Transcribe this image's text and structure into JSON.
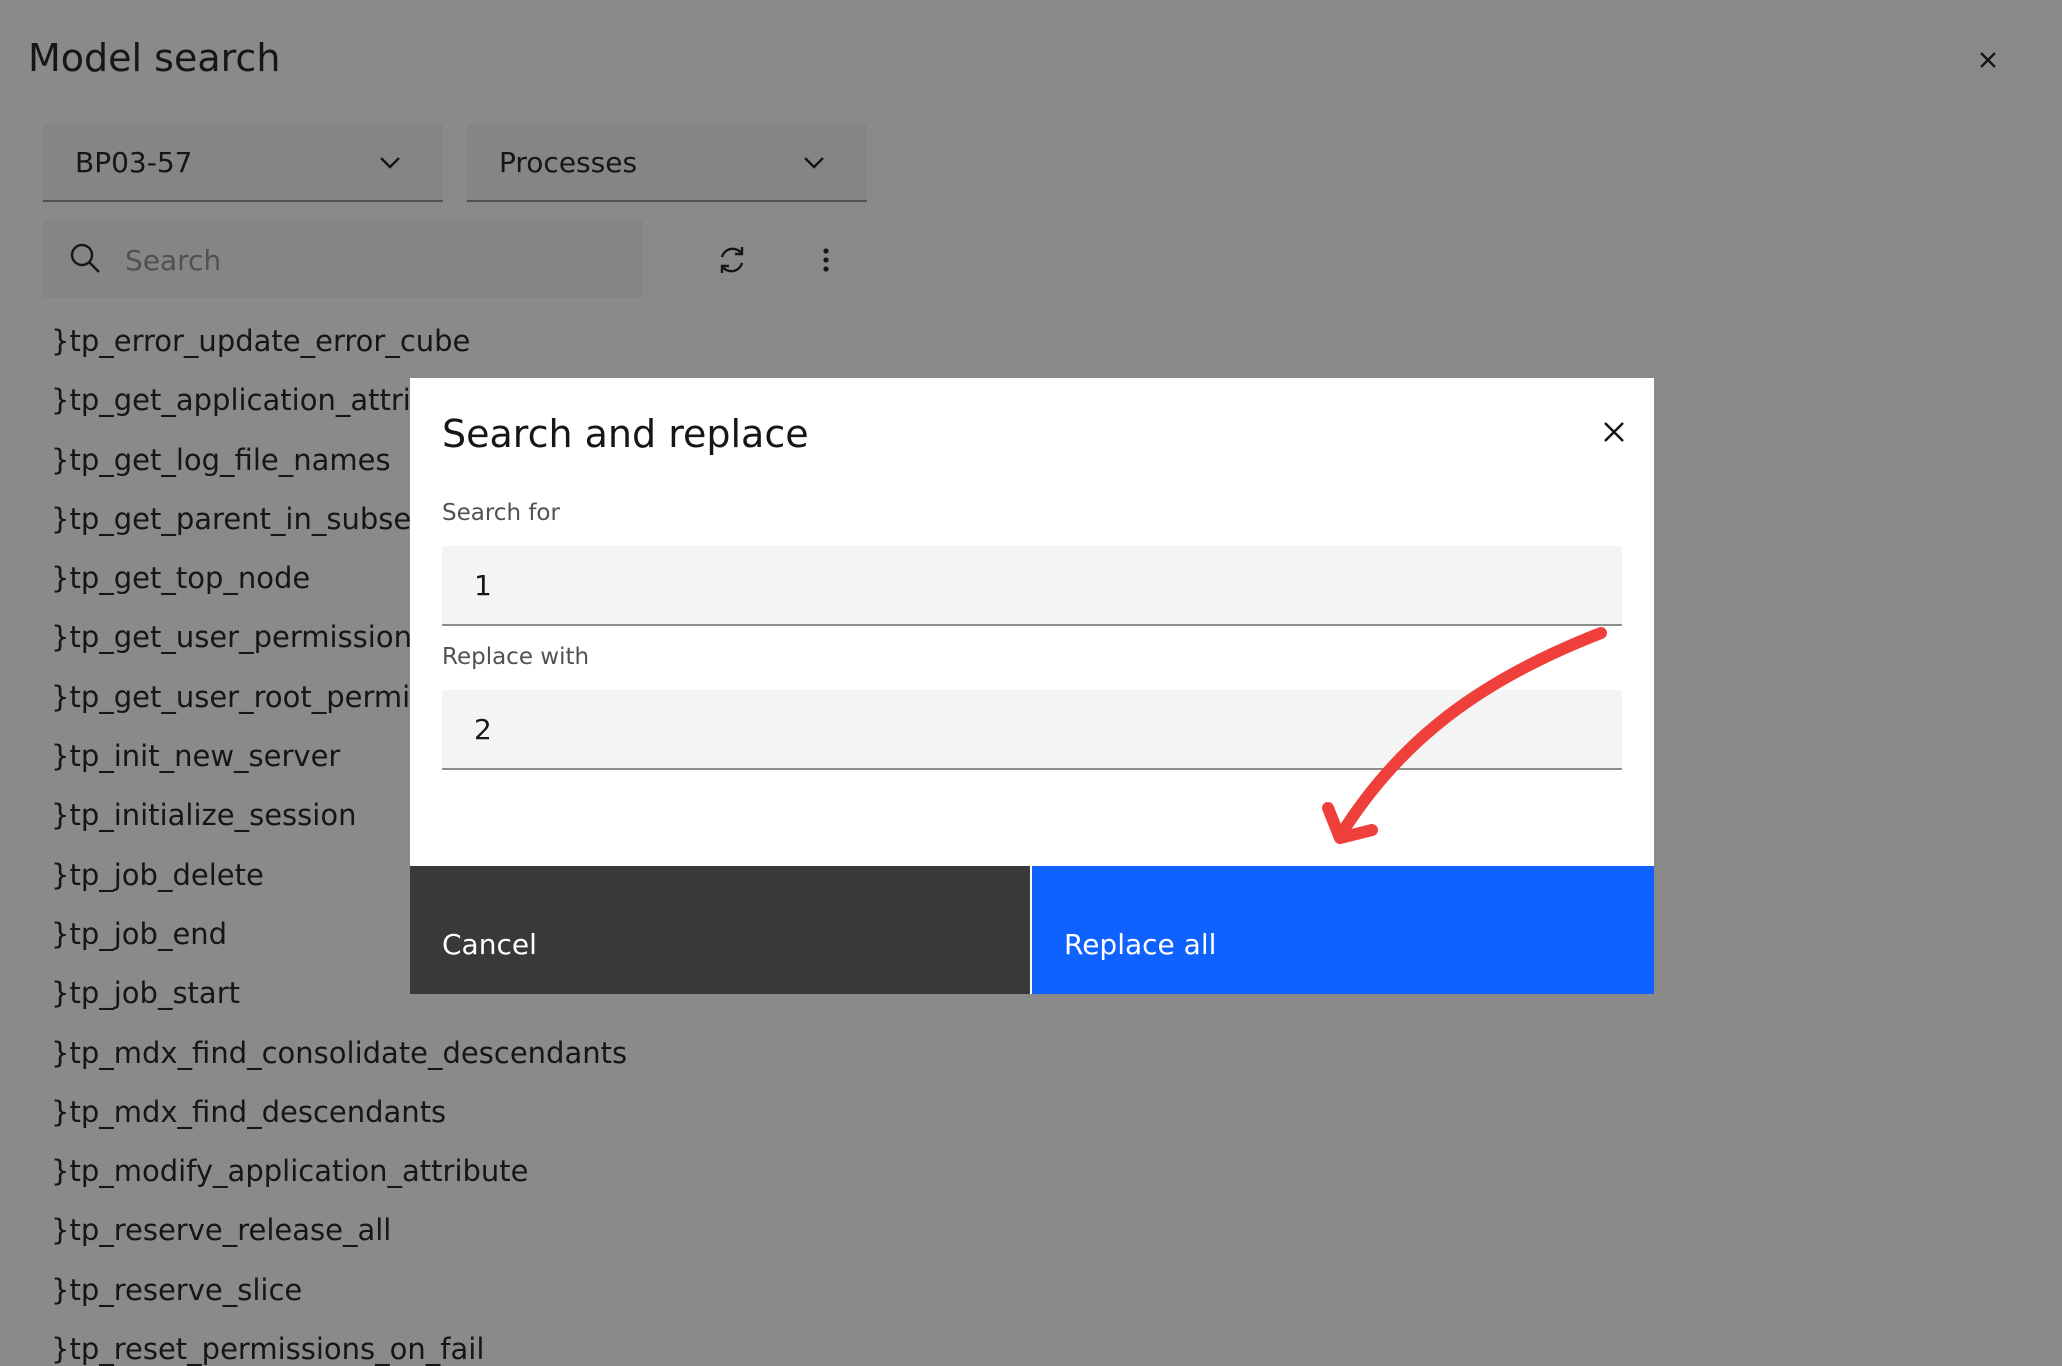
{
  "panel": {
    "title": "Model search",
    "model_dropdown": {
      "selected": "BP03-57"
    },
    "type_dropdown": {
      "selected": "Processes"
    },
    "search": {
      "placeholder": "Search",
      "value": ""
    },
    "items": [
      "}tp_error_update_error_cube",
      "}tp_get_application_attribute",
      "}tp_get_log_file_names",
      "}tp_get_parent_in_subset",
      "}tp_get_top_node",
      "}tp_get_user_permissions",
      "}tp_get_user_root_permissions",
      "}tp_init_new_server",
      "}tp_initialize_session",
      "}tp_job_delete",
      "}tp_job_end",
      "}tp_job_start",
      "}tp_mdx_find_consolidate_descendants",
      "}tp_mdx_find_descendants",
      "}tp_modify_application_attribute",
      "}tp_reserve_release_all",
      "}tp_reserve_slice",
      "}tp_reset_permissions_on_fail"
    ],
    "icons": {
      "close": "close-icon",
      "chevron": "chevron-down-icon",
      "search": "search-icon",
      "refresh": "refresh-icon",
      "more": "overflow-menu-icon"
    }
  },
  "dialog": {
    "title": "Search and replace",
    "search_for_label": "Search for",
    "search_for_value": "1",
    "replace_with_label": "Replace with",
    "replace_with_value": "2",
    "cancel_label": "Cancel",
    "replace_all_label": "Replace all"
  },
  "colors": {
    "primary_button": "#0f62fe",
    "secondary_button": "#393939",
    "field_background": "#f4f4f4",
    "overlay": "rgba(22,22,22,0.5)",
    "annotation_arrow": "#ee3f3a"
  }
}
